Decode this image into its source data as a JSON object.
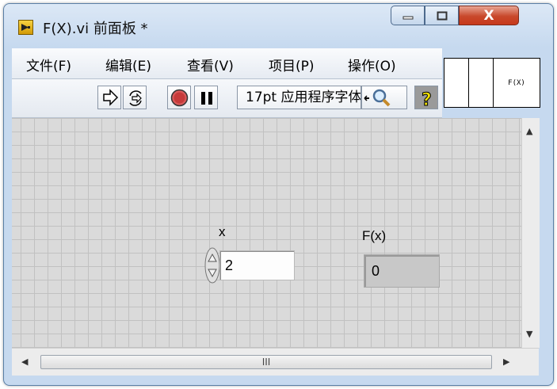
{
  "window": {
    "title": "F(X).vi 前面板 *",
    "close_glyph": "X"
  },
  "menubar": {
    "items": [
      "文件(F)",
      "编辑(E)",
      "查看(V)",
      "项目(P)",
      "操作(O)"
    ]
  },
  "toolbar": {
    "font_select": "17pt 应用程序字体"
  },
  "icon_pane": {
    "text": "F(X)"
  },
  "controls": {
    "input": {
      "label": "x",
      "value": "2"
    },
    "output": {
      "label": "F(x)",
      "value": "0"
    }
  },
  "scrollbar": {
    "thumb_grip": "III"
  },
  "colors": {
    "window_frame": "#c6d9ef",
    "close_button": "#c7391b",
    "panel_bg": "#dadada",
    "grid": "#c1c1c1"
  }
}
